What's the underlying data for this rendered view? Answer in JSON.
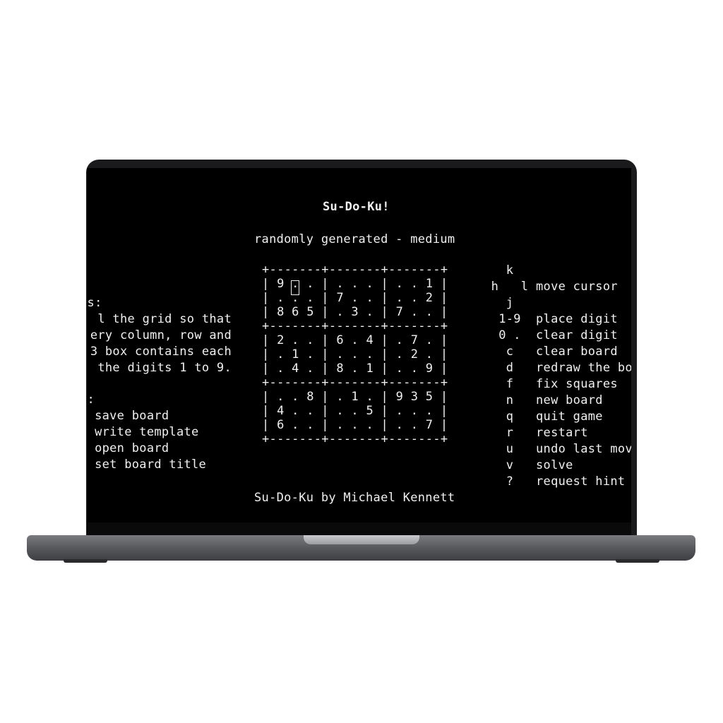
{
  "title": "Su-Do-Ku!",
  "subtitle": "randomly generated - medium",
  "grid_lines": [
    "+-------+-------+-------+",
    "| 9 . . | . . . | . . 1 |",
    "| . . . | 7 . . | . . 2 |",
    "| 8 6 5 | . 3 . | 7 . . |",
    "+-------+-------+-------+",
    "| 2 . . | 6 . 4 | . 7 . |",
    "| . 1 . | . . . | . 2 . |",
    "| . 4 . | 8 . 1 | . . 9 |",
    "+-------+-------+-------+",
    "| . . 8 | . 1 . | 9 3 5 |",
    "| 4 . . | . . 5 | . . . |",
    "| 6 . . | . . . | . . 7 |",
    "+-------+-------+-------+"
  ],
  "footer": "Su-Do-Ku by Michael Kennett",
  "left_help": {
    "rules": [
      "es:",
      "l the grid so that",
      "ery column, row and",
      "3 box contains each",
      " the digits 1 to 9."
    ],
    "files_header": "e:",
    "files": [
      "  save board",
      "  write template",
      "  open board",
      "  set board title"
    ]
  },
  "keys": [
    {
      "key": "k",
      "desc": ""
    },
    {
      "key": "h   l",
      "desc": "move cursor"
    },
    {
      "key": "j",
      "desc": ""
    },
    {
      "key": "1-9",
      "desc": "place digit"
    },
    {
      "key": "0 .",
      "desc": "clear digit"
    },
    {
      "key": "c",
      "desc": "clear board"
    },
    {
      "key": "d",
      "desc": "redraw the bo"
    },
    {
      "key": "f",
      "desc": "fix squares"
    },
    {
      "key": "n",
      "desc": "new board"
    },
    {
      "key": "q",
      "desc": "quit game"
    },
    {
      "key": "r",
      "desc": "restart"
    },
    {
      "key": "u",
      "desc": "undo last mov"
    },
    {
      "key": "v",
      "desc": "solve"
    },
    {
      "key": "?",
      "desc": "request hint"
    }
  ]
}
